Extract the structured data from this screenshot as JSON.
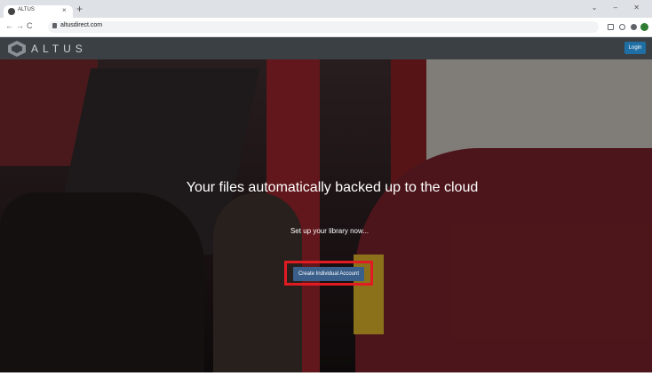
{
  "browser": {
    "tab_title": "ALTUS",
    "tab_close": "×",
    "new_tab": "+",
    "window_controls": "⌄ – ✕",
    "back": "←",
    "forward": "→",
    "reload": "C",
    "url": "altusdirect.com"
  },
  "site": {
    "logo_text": "ALTUS",
    "login_label": "Login"
  },
  "hero": {
    "headline": "Your files automatically backed up to the cloud",
    "subtext": "Set up your library now...",
    "cta_label": "Create Individual Account",
    "highlight_color": "#e11b22"
  }
}
